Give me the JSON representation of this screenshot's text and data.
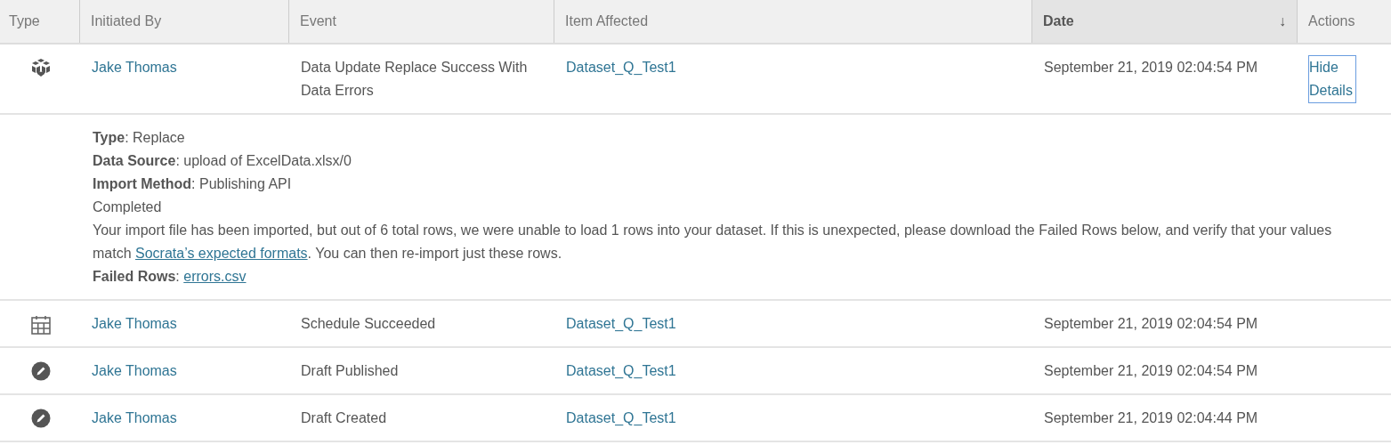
{
  "table": {
    "columns": [
      {
        "label": "Type",
        "selected": false
      },
      {
        "label": "Initiated By",
        "selected": false
      },
      {
        "label": "Event",
        "selected": false
      },
      {
        "label": "Item Affected",
        "selected": false
      },
      {
        "label": "Date",
        "selected": true,
        "sort": "↓"
      },
      {
        "label": "Actions",
        "selected": false
      }
    ],
    "rows": [
      {
        "kind": "dataset",
        "initiated_by": "Jake Thomas",
        "event": "Data Update Replace Success With Data Errors",
        "item": "Dataset_Q_Test1",
        "date": "September 21, 2019 02:04:54 PM",
        "action": "Hide Details",
        "details": [
          {
            "kind": "field",
            "text": "**Type**: Replace"
          },
          {
            "kind": "field",
            "text": "**Data Source**: upload of ExcelData.xlsx/0"
          },
          {
            "kind": "field",
            "text": "**Import Method**: Publishing API"
          },
          {
            "kind": "text",
            "text": "Completed"
          },
          {
            "kind": "message",
            "before": "Your import file has been imported, but out of 6 total rows, we were unable to load 1 rows into your dataset. If this is unexpected, please download the Failed Rows below, and verify that your values match",
            "link": "Socrata’s expected formats",
            "after": ". You can then re-import just these rows."
          },
          {
            "kind": "field_link",
            "label": "**Failed Rows**:",
            "link": "errors.csv"
          }
        ]
      },
      {
        "kind": "schedule",
        "initiated_by": "Jake Thomas",
        "event": "Schedule Succeeded",
        "item": "Dataset_Q_Test1",
        "date": "September 21, 2019 02:04:54 PM"
      },
      {
        "kind": "edit",
        "initiated_by": "Jake Thomas",
        "event": "Draft Published",
        "item": "Dataset_Q_Test1",
        "date": "September 21, 2019 02:04:54 PM"
      },
      {
        "kind": "edit",
        "initiated_by": "Jake Thomas",
        "event": "Draft Created",
        "item": "Dataset_Q_Test1",
        "date": "September 21, 2019 02:04:44 PM"
      }
    ]
  }
}
